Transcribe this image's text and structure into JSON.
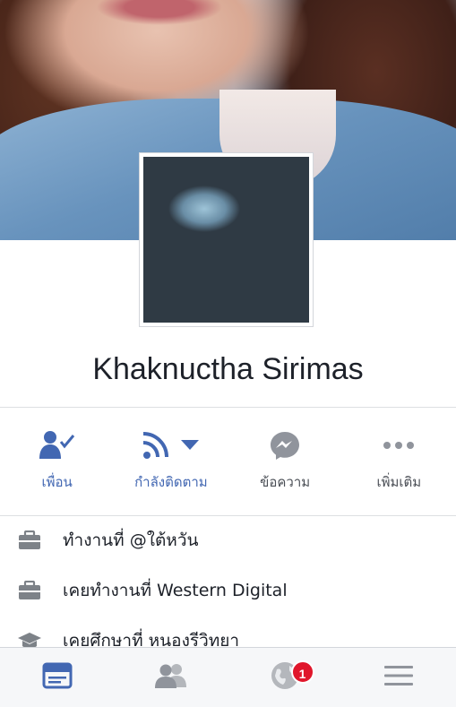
{
  "profile": {
    "name": "Khaknuctha Sirimas"
  },
  "actions": [
    {
      "label": "เพื่อน",
      "icon": "friend-check-icon"
    },
    {
      "label": "กำลังติดตาม",
      "icon": "follow-rss-icon"
    },
    {
      "label": "ข้อความ",
      "icon": "messenger-icon"
    },
    {
      "label": "เพิ่มเติม",
      "icon": "more-dots-icon"
    }
  ],
  "info": [
    {
      "text": "ทำงานที่ @ใต้หวัน",
      "icon": "briefcase-icon"
    },
    {
      "text": "เคยทำงานที่ Western Digital",
      "icon": "briefcase-icon"
    },
    {
      "text": "เคยศึกษาที่ หนองรีวิทยา",
      "icon": "graduation-cap-icon"
    }
  ],
  "tabbar": {
    "tabs": [
      "news-feed-icon",
      "friend-requests-icon",
      "notifications-globe-icon",
      "menu-icon"
    ],
    "notification_count": "1"
  },
  "colors": {
    "accent": "#4267b2",
    "gray_icon": "#90949c",
    "badge": "#e0162b"
  }
}
